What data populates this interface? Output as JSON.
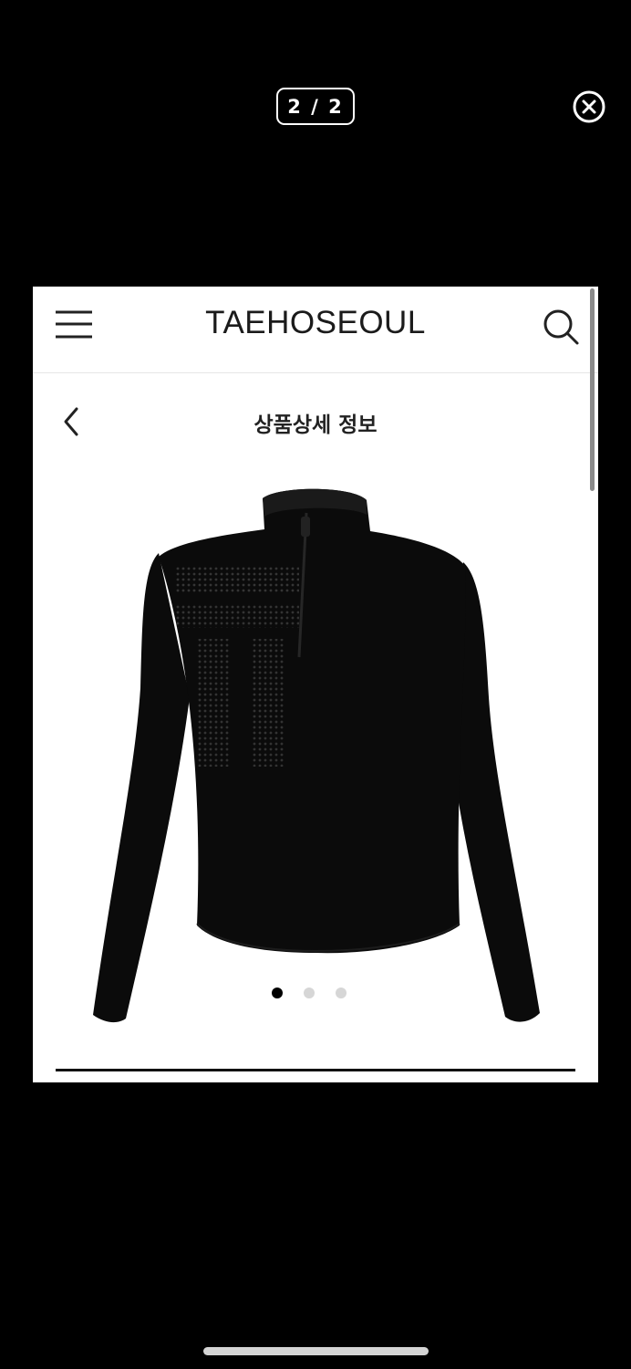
{
  "viewer": {
    "counter": "2 / 2",
    "close_icon": "close-circle-icon"
  },
  "header": {
    "brand": "TAEHOSEOUL",
    "menu_icon": "hamburger-menu-icon",
    "search_icon": "search-icon"
  },
  "subheader": {
    "back_icon": "chevron-left-icon",
    "title": "상품상세 정보"
  },
  "carousel": {
    "image_description_icon": "black-quarter-zip-long-sleeve-top",
    "slides": 3,
    "active_index": 0
  },
  "colors": {
    "background": "#000000",
    "panel": "#ffffff",
    "garment": "#0b0b0b",
    "dot_active": "#000000",
    "dot_inactive": "#d6d6d6"
  }
}
